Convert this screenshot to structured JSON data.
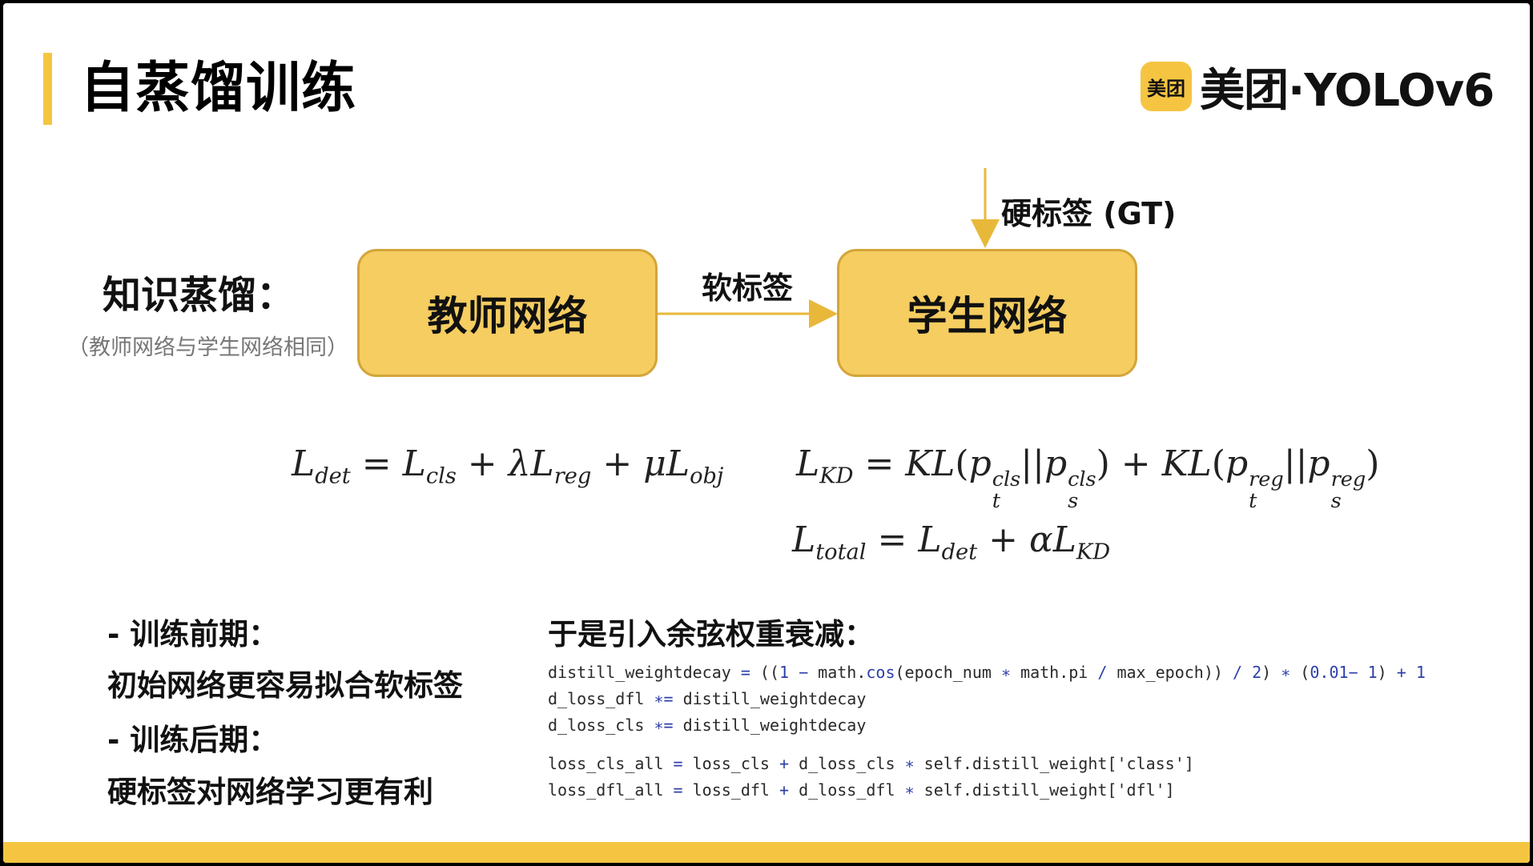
{
  "title": "自蒸馏训练",
  "logo": {
    "badge": "美团",
    "text": "美团·YOLOv6"
  },
  "diagram": {
    "kd_label": "知识蒸馏：",
    "kd_sub": "（教师网络与学生网络相同）",
    "teacher": "教师网络",
    "student": "学生网络",
    "soft_label": "软标签",
    "gt_label": "硬标签 (GT)"
  },
  "phases": {
    "early_title": "- 训练前期：",
    "early_desc": "初始网络更容易拟合软标签",
    "late_title": "- 训练后期：",
    "late_desc": "硬标签对网络学习更有利"
  },
  "cosine_title": "于是引入余弦权重衰减：",
  "colors": {
    "accent": "#f5c542",
    "box_fill": "#f5cd60",
    "box_border": "#d4a53a",
    "code_keyword": "#2d3fa8"
  }
}
